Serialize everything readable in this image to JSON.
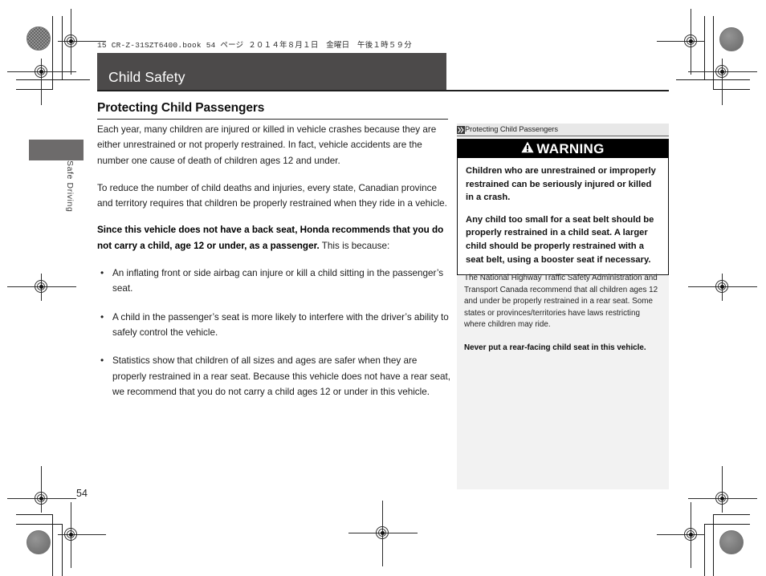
{
  "print_header": "15 CR-Z-31SZT6400.book  54 ページ  ２０１４年８月１日　金曜日　午後１時５９分",
  "chapter": {
    "title": "Child Safety"
  },
  "side_tab": {
    "label": "Safe Driving"
  },
  "section": {
    "heading": "Protecting Child Passengers"
  },
  "body": {
    "paragraph_1": "Each year, many children are injured or killed in vehicle crashes because they are either unrestrained or not properly restrained. In fact, vehicle accidents are the number one cause of death of children ages 12 and under.",
    "paragraph_2": "To reduce the number of child deaths and injuries, every state, Canadian province and territory requires that children be properly restrained when they ride in a vehicle.",
    "paragraph_3_bold": "Since this vehicle does not have a back seat, Honda recommends that you do not carry a child, age 12 or under, as a passenger.",
    "paragraph_3_rest": " This is because:",
    "bullets": [
      "An inflating front or side airbag can injure or kill a child sitting in the passenger’s seat.",
      "A child in the passenger’s seat is more likely to interfere with the driver’s ability to safely control the vehicle.",
      "Statistics show that children of all sizes and ages are safer when they are properly restrained in a rear seat. Because this vehicle does not have a rear seat, we recommend that you do not carry a child ages 12 or under in this vehicle."
    ]
  },
  "sidebar": {
    "reference_label": "Protecting Child Passengers",
    "reference_icon": "reference-mark-icon",
    "warning": {
      "icon": "warning-triangle-icon",
      "title": "WARNING",
      "paragraphs": [
        "Children who are unrestrained or improperly restrained can be seriously injured or killed in a crash.",
        "Any child too small for a seat belt should be properly restrained in a child seat. A larger child should be properly restrained with a seat belt, using a booster seat if necessary."
      ]
    },
    "note": "The National Highway Traffic Safety Administration and Transport Canada recommend that all children ages 12 and under be properly restrained in a rear seat. Some states or provinces/territories have laws restricting where children may ride.",
    "note_bold": "Never put a rear-facing child seat in this vehicle."
  },
  "page_number": "54",
  "colors": {
    "chapter_bar": "#4c4a4a",
    "warning_bar": "#000000",
    "sidebar_panel": "#f2f2f2",
    "tab_block": "#6d6b6b"
  }
}
